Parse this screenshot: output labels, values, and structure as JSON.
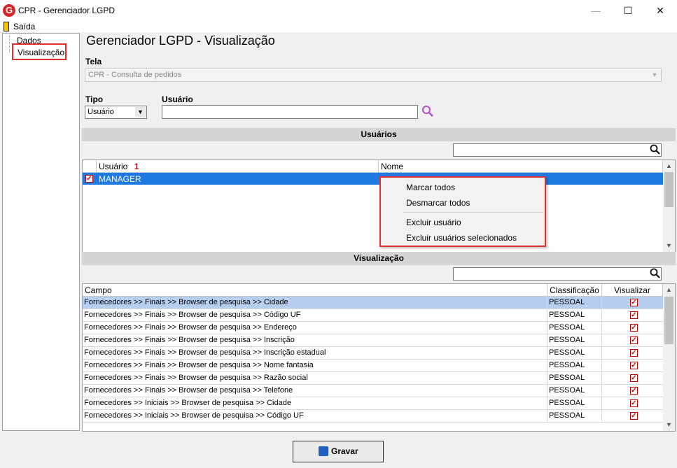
{
  "window": {
    "title": "CPR - Gerenciador LGPD",
    "logo": "G"
  },
  "menu": {
    "saida": "Saída"
  },
  "tree": {
    "items": [
      {
        "label": "Dados"
      },
      {
        "label": "Visualização"
      }
    ]
  },
  "page": {
    "title": "Gerenciador LGPD - Visualização"
  },
  "tela": {
    "label": "Tela",
    "value": "CPR - Consulta de pedidos"
  },
  "tipo": {
    "label": "Tipo",
    "value": "Usuário"
  },
  "usuario": {
    "label": "Usuário",
    "value": ""
  },
  "users_section": {
    "header": "Usuários",
    "search_value": "",
    "columns": [
      "Usuário",
      "Nome"
    ],
    "sort_indicator": "1",
    "rows": [
      {
        "checked": true,
        "usuario": "MANAGER",
        "nome": ""
      }
    ]
  },
  "context_menu": {
    "items": [
      "Marcar todos",
      "Desmarcar todos",
      "Excluir usuário",
      "Excluir usuários selecionados"
    ]
  },
  "vis_section": {
    "header": "Visualização",
    "search_value": "",
    "columns": [
      "Campo",
      "Classificação",
      "Visualizar"
    ],
    "rows": [
      {
        "campo": "Fornecedores >> Finais >> Browser de pesquisa >> Cidade",
        "classificacao": "PESSOAL",
        "visualizar": true
      },
      {
        "campo": "Fornecedores >> Finais >> Browser de pesquisa >> Código UF",
        "classificacao": "PESSOAL",
        "visualizar": true
      },
      {
        "campo": "Fornecedores >> Finais >> Browser de pesquisa >> Endereço",
        "classificacao": "PESSOAL",
        "visualizar": true
      },
      {
        "campo": "Fornecedores >> Finais >> Browser de pesquisa >> Inscrição",
        "classificacao": "PESSOAL",
        "visualizar": true
      },
      {
        "campo": "Fornecedores >> Finais >> Browser de pesquisa >> Inscrição estadual",
        "classificacao": "PESSOAL",
        "visualizar": true
      },
      {
        "campo": "Fornecedores >> Finais >> Browser de pesquisa >> Nome fantasia",
        "classificacao": "PESSOAL",
        "visualizar": true
      },
      {
        "campo": "Fornecedores >> Finais >> Browser de pesquisa >> Razão social",
        "classificacao": "PESSOAL",
        "visualizar": true
      },
      {
        "campo": "Fornecedores >> Finais >> Browser de pesquisa >> Telefone",
        "classificacao": "PESSOAL",
        "visualizar": true
      },
      {
        "campo": "Fornecedores >> Iniciais >> Browser de pesquisa >> Cidade",
        "classificacao": "PESSOAL",
        "visualizar": true
      },
      {
        "campo": "Fornecedores >> Iniciais >> Browser de pesquisa >> Código UF",
        "classificacao": "PESSOAL",
        "visualizar": true
      }
    ]
  },
  "actions": {
    "gravar": "Gravar"
  },
  "colors": {
    "accent": "#1e7ae0",
    "highlight_border": "#e03030",
    "selected_row": "#b6cef0"
  }
}
